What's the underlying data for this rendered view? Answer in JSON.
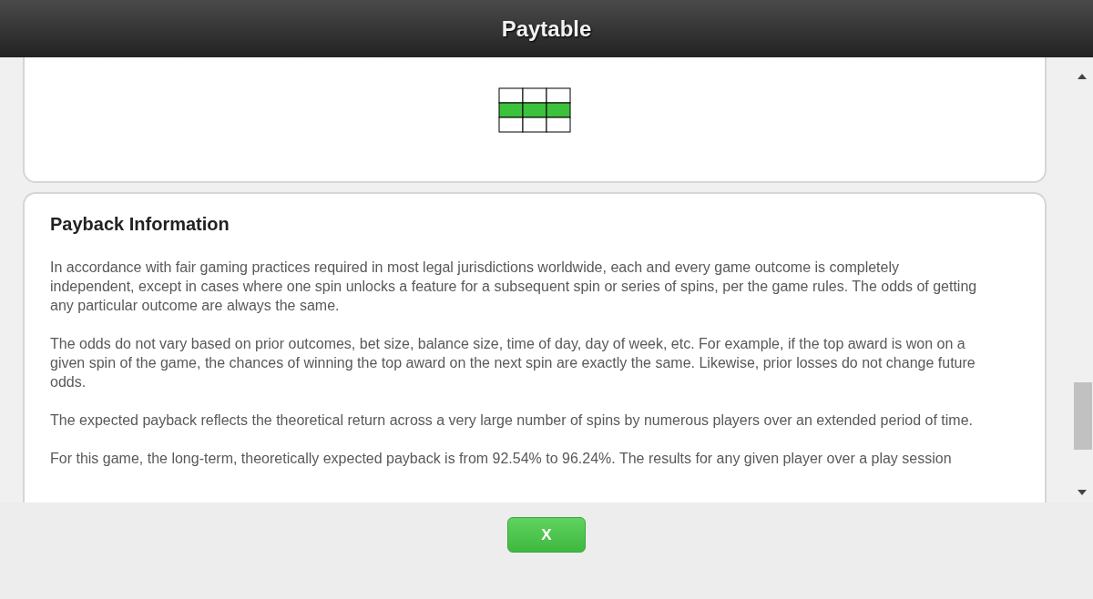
{
  "header": {
    "title": "Paytable"
  },
  "payline": {
    "rows": [
      [
        false,
        false,
        false
      ],
      [
        true,
        true,
        true
      ],
      [
        false,
        false,
        false
      ]
    ]
  },
  "payback": {
    "heading": "Payback Information",
    "paragraphs": [
      "In accordance with fair gaming practices required in most legal jurisdictions worldwide, each and every game outcome is completely independent, except in cases where one spin unlocks a feature for a subsequent spin or series of spins, per the game rules. The odds of getting any particular outcome are always the same.",
      "The odds do not vary based on prior outcomes, bet size, balance size, time of day, day of week, etc. For example, if the top award is won on a given spin of the game, the chances of winning the top award on the next spin are exactly the same. Likewise, prior losses do not change future odds.",
      "The expected payback reflects the theoretical return across a very large number of spins by numerous players over an extended period of time.",
      "For this game, the long-term, theoretically expected payback is from 92.54% to 96.24%. The results for any given player over a play session"
    ]
  },
  "close_button": {
    "label": "X"
  }
}
